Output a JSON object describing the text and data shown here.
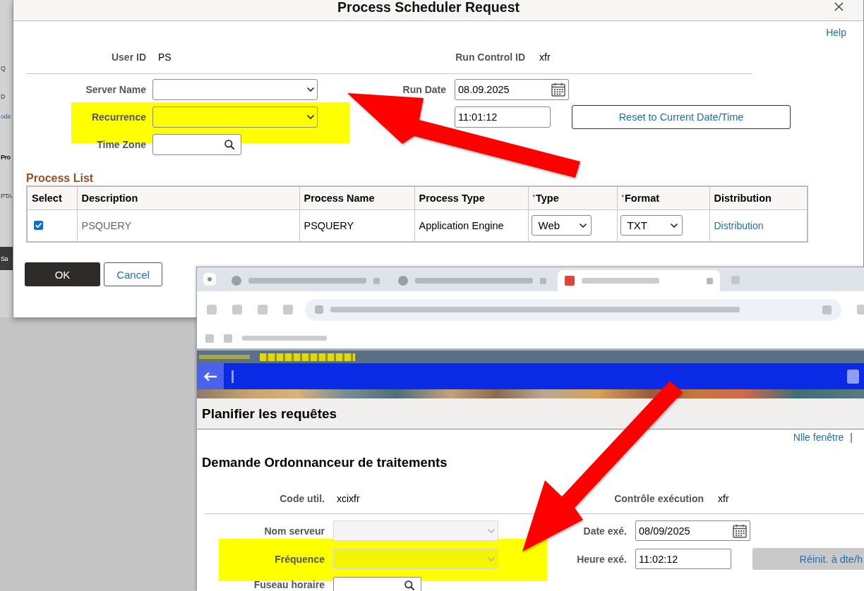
{
  "background_page": {
    "fragments": [
      {
        "kind": "text",
        "text": "Q"
      },
      {
        "kind": "text",
        "text": "D"
      },
      {
        "kind": "link",
        "text": "oda"
      },
      {
        "kind": "heading",
        "text": "Pro"
      },
      {
        "kind": "text",
        "text": "PTA"
      },
      {
        "kind": "button",
        "text": "Sa"
      }
    ]
  },
  "dialog": {
    "title": "Process Scheduler Request",
    "help_link": "Help",
    "info": [
      {
        "label": "User ID",
        "value": "PS"
      },
      {
        "label": "Run Control ID",
        "value": "xfr"
      }
    ],
    "form_rows": [
      {
        "highlighted": false,
        "left": {
          "label": "Server Name",
          "kind": "select",
          "disabled": false
        },
        "right": {
          "label": "Run Date",
          "kind": "date",
          "value": "08.09.2025",
          "disabled": false
        }
      },
      {
        "highlighted": true,
        "left": {
          "label": "Recurrence",
          "kind": "select",
          "disabled": false
        },
        "right": {
          "kind": "text",
          "value": "11:01:12",
          "disabled": false
        },
        "action": {
          "label": "Reset to Current Date/Time",
          "disabled": false
        }
      },
      {
        "highlighted": false,
        "left": {
          "label": "Time Zone",
          "kind": "lookup",
          "disabled": false
        }
      }
    ],
    "process_list": {
      "title": "Process List",
      "columns": [
        {
          "label": "Select"
        },
        {
          "label": "Description"
        },
        {
          "label": "Process Name"
        },
        {
          "label": "Process Type"
        },
        {
          "label": "Type",
          "required_mark": "*"
        },
        {
          "label": "Format",
          "required_mark": "*"
        },
        {
          "label": "Distribution"
        }
      ],
      "rows": [
        {
          "checked": true,
          "description": "PSQUERY",
          "process_name": "PSQUERY",
          "process_type": "Application Engine",
          "type": "Web",
          "format": "TXT",
          "distribution": "Distribution"
        }
      ]
    },
    "buttons": [
      {
        "label": "OK",
        "kind": "primary"
      },
      {
        "label": "Cancel",
        "kind": "secondary"
      }
    ]
  },
  "browser": {
    "tabs": [
      {
        "selected": false
      },
      {
        "selected": false
      },
      {
        "selected": true
      }
    ],
    "page": {
      "header": "Planifier les requêtes",
      "links": [
        "Nlle fenêtre"
      ],
      "link_separator": "|",
      "title": "Demande Ordonnanceur de traitements",
      "info": [
        {
          "label": "Code util.",
          "value": "xcixfr"
        },
        {
          "label": "Contrôle exécution",
          "value": "xfr"
        }
      ],
      "form_rows": [
        {
          "highlighted": false,
          "left": {
            "label": "Nom serveur",
            "kind": "select",
            "disabled": true
          },
          "right": {
            "label": "Date exé.",
            "kind": "date",
            "value": "08/09/2025",
            "disabled": false
          }
        },
        {
          "highlighted": true,
          "left": {
            "label": "Fréquence",
            "kind": "select",
            "disabled": true
          },
          "right": {
            "label": "Heure exé.",
            "kind": "text",
            "value": "11:02:12",
            "disabled": false
          },
          "action": {
            "label": "Réinit. à dte/h",
            "disabled": true
          }
        },
        {
          "highlighted": false,
          "left": {
            "label": "Fuseau horaire",
            "kind": "lookup",
            "disabled": false
          }
        }
      ]
    }
  }
}
